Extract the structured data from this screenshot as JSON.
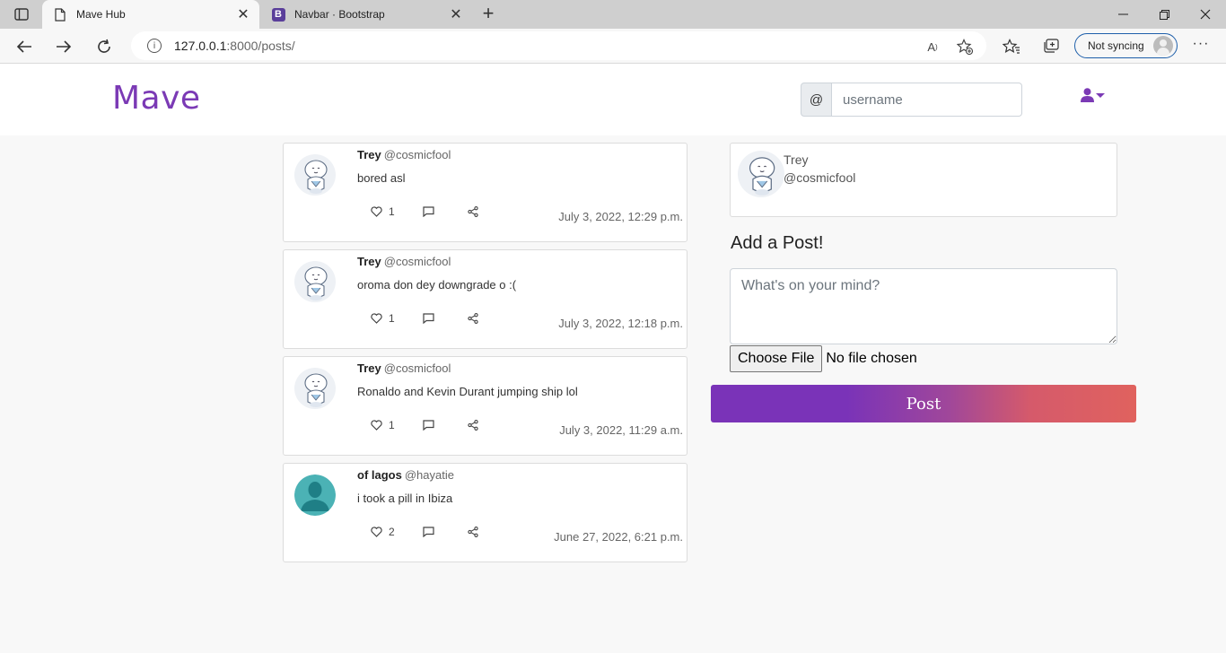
{
  "browser": {
    "tabs": [
      {
        "title": "Mave Hub",
        "active": true
      },
      {
        "title": "Navbar · Bootstrap",
        "active": false,
        "favicon": "B"
      }
    ],
    "url_host": "127.0.0.1",
    "url_rest": ":8000/posts/",
    "sync_label": "Not syncing"
  },
  "header": {
    "brand": "Mave",
    "search_prefix": "@",
    "search_placeholder": "username",
    "accent_color": "#7b3ab5"
  },
  "posts": [
    {
      "name": "Trey",
      "handle": "@cosmicfool",
      "text": "bored asl",
      "likes": "1",
      "time": "July 3, 2022, 12:29 p.m.",
      "avatar": "mascot"
    },
    {
      "name": "Trey",
      "handle": "@cosmicfool",
      "text": "oroma don dey downgrade o :(",
      "likes": "1",
      "time": "July 3, 2022, 12:18 p.m.",
      "avatar": "mascot"
    },
    {
      "name": "Trey",
      "handle": "@cosmicfool",
      "text": "Ronaldo and Kevin Durant jumping ship lol",
      "likes": "1",
      "time": "July 3, 2022, 11:29 a.m.",
      "avatar": "mascot"
    },
    {
      "name": "of lagos",
      "handle": "@hayatie",
      "text": "i took a pill in Ibiza",
      "likes": "2",
      "time": "June 27, 2022, 6:21 p.m.",
      "avatar": "default-user"
    }
  ],
  "sidebar": {
    "profile_name": "Trey",
    "profile_handle": "@cosmicfool",
    "add_title": "Add a Post!",
    "textarea_placeholder": "What's on your mind?",
    "file_button": "Choose File",
    "file_status": "No file chosen",
    "post_button": "Post"
  }
}
